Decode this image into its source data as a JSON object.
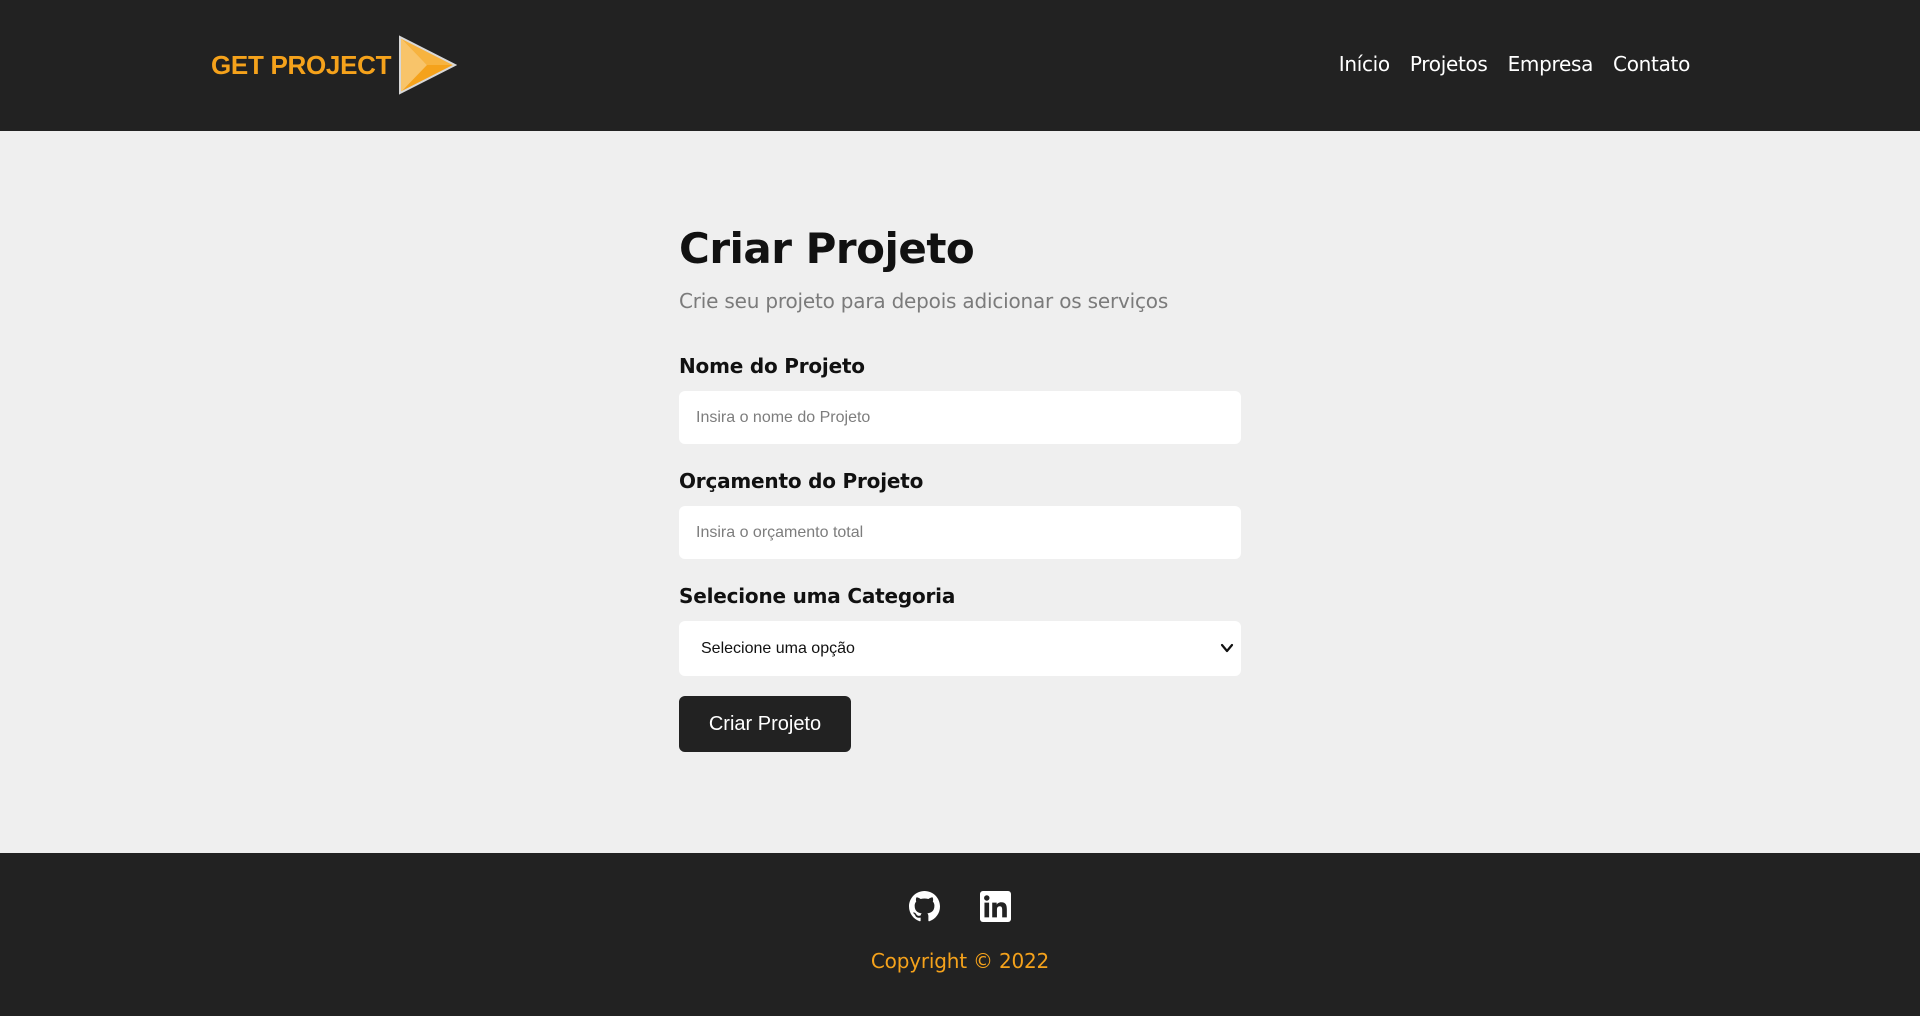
{
  "colors": {
    "navbar_bg": "#222222",
    "page_bg": "#efefef",
    "accent": "#f5a21b",
    "button_bg": "#222222"
  },
  "navbar": {
    "logo_text": "GET PROJECT",
    "logo_icon": "play-triangle-icon",
    "links": [
      {
        "label": "Início"
      },
      {
        "label": "Projetos"
      },
      {
        "label": "Empresa"
      },
      {
        "label": "Contato"
      }
    ]
  },
  "form": {
    "title": "Criar Projeto",
    "subtitle": "Crie seu projeto para depois adicionar os serviços",
    "name_field": {
      "label": "Nome do Projeto",
      "placeholder": "Insira o nome do Projeto",
      "value": ""
    },
    "budget_field": {
      "label": "Orçamento do Projeto",
      "placeholder": "Insira o orçamento total",
      "value": ""
    },
    "category_field": {
      "label": "Selecione uma Categoria",
      "selected": "Selecione uma opção"
    },
    "submit_label": "Criar Projeto"
  },
  "footer": {
    "social": [
      "github-icon",
      "linkedin-icon"
    ],
    "copyright": "Copyright © 2022"
  }
}
